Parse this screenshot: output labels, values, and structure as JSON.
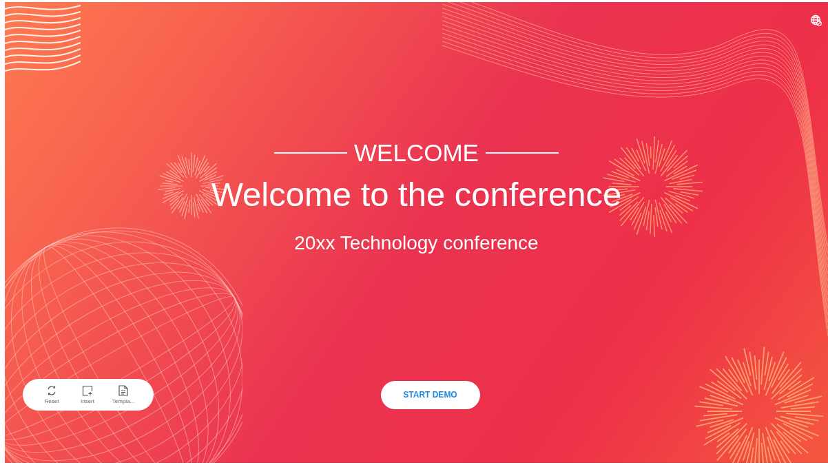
{
  "slide": {
    "eyebrow": "WELCOME",
    "title": "Welcome to the conference",
    "subtitle": "20xx Technology conference"
  },
  "toolbar": [
    {
      "label": "Reset",
      "kind": "reset"
    },
    {
      "label": "Insert",
      "kind": "insert"
    },
    {
      "label": "Templa...",
      "kind": "template"
    }
  ],
  "start_button": {
    "label": "START DEMO"
  }
}
